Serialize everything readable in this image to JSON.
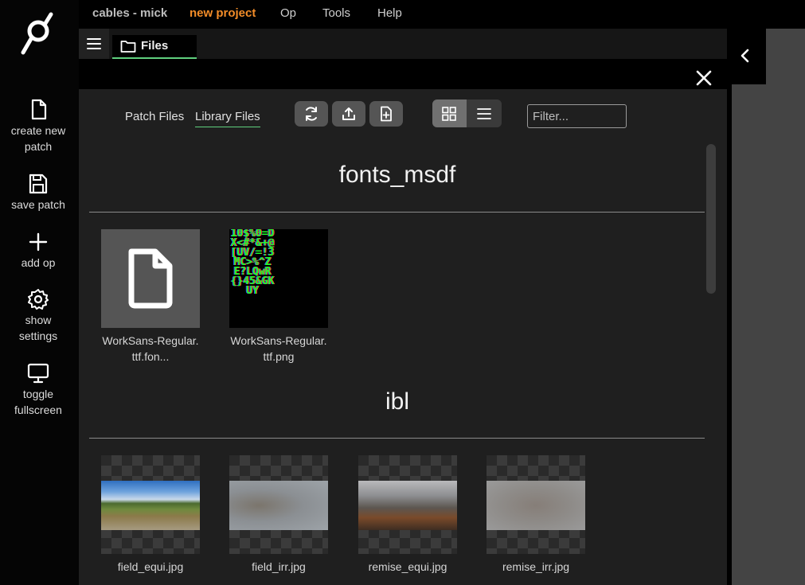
{
  "menu": {
    "app_title": "cables - mick",
    "project": "new project",
    "items": [
      "Op",
      "Tools",
      "Help"
    ]
  },
  "sidebar": {
    "items": [
      {
        "label": "create new patch",
        "icon": "file-icon"
      },
      {
        "label": "save patch",
        "icon": "save-icon"
      },
      {
        "label": "add op",
        "icon": "plus-icon"
      },
      {
        "label": "show settings",
        "icon": "gear-icon"
      },
      {
        "label": "toggle fullscreen",
        "icon": "monitor-icon"
      }
    ]
  },
  "tabbar": {
    "active_tab": "Files"
  },
  "files_panel": {
    "tabs": {
      "patch": "Patch Files",
      "library": "Library Files",
      "active": "library"
    },
    "filter_placeholder": "Filter...",
    "view_mode": "grid",
    "sections": [
      {
        "title": "fonts_msdf",
        "files": [
          {
            "name_line1": "WorkSans-Regular.",
            "name_line2": "ttf.fon...",
            "kind": "document"
          },
          {
            "name_line1": "WorkSans-Regular.",
            "name_line2": "ttf.png",
            "kind": "image",
            "glyph_text": "10$%0=DX<#*&+@[UV/=!3MC>%^ZE?LQwR{}45&GKUY"
          }
        ]
      },
      {
        "title": "ibl",
        "files": [
          {
            "name": "field_equi.jpg",
            "kind": "panorama"
          },
          {
            "name": "field_irr.jpg",
            "kind": "panorama-blur"
          },
          {
            "name": "remise_equi.jpg",
            "kind": "panorama-room"
          },
          {
            "name": "remise_irr.jpg",
            "kind": "panorama-blur"
          }
        ]
      }
    ]
  },
  "colors": {
    "accent_orange": "#f28c28",
    "accent_green": "#5fcf7d",
    "panel_bg": "#1f1f1f"
  }
}
